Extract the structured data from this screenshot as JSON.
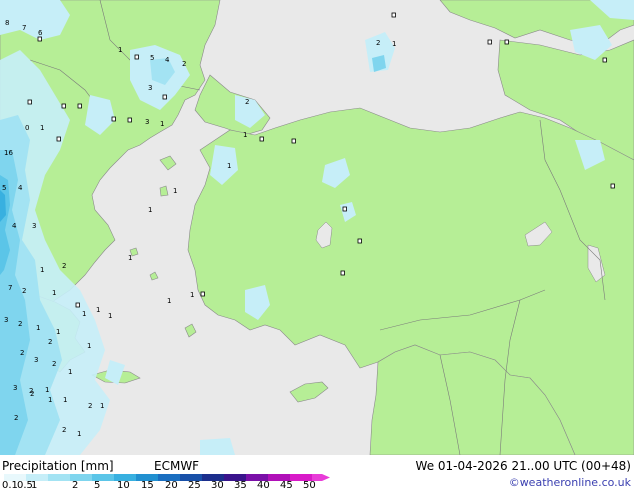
{
  "title": "Precipitation [mm]",
  "model": "ECMWF",
  "valid_time": "We 01-04-2026 21..00 UTC (00+48)",
  "credit": "©weatheronline.co.uk",
  "colors": {
    "sea": "#e9e9e9",
    "land": "#b6ee96",
    "border": "#7a7a7a",
    "coast": "#8a8a8a"
  },
  "legend": {
    "labels": [
      "0.1",
      "0.5",
      "1",
      "2",
      "5",
      "10",
      "15",
      "20",
      "25",
      "30",
      "35",
      "40",
      "45",
      "50"
    ],
    "colors": [
      "#e8f8fc",
      "#c6eef8",
      "#a3e3f3",
      "#7fd5ee",
      "#5bc5e8",
      "#38b0e0",
      "#2190d0",
      "#1a6ec0",
      "#1850a8",
      "#1c2e8c",
      "#3a148c",
      "#7a10a8",
      "#b010b8",
      "#d81ac8",
      "#e83cd8"
    ]
  },
  "map_labels": [
    {
      "t": "8"
    },
    {
      "t": "7"
    },
    {
      "t": "6"
    },
    {
      "t": "5"
    },
    {
      "t": "1"
    },
    {
      "t": "4"
    },
    {
      "t": "2"
    },
    {
      "t": "3"
    },
    {
      "t": "0"
    },
    {
      "t": "1"
    },
    {
      "t": "2"
    },
    {
      "t": "1"
    },
    {
      "t": "2"
    },
    {
      "t": "1"
    },
    {
      "t": "1"
    },
    {
      "t": "3"
    },
    {
      "t": "1"
    },
    {
      "t": "16"
    },
    {
      "t": "4"
    },
    {
      "t": "5"
    },
    {
      "t": "3"
    },
    {
      "t": "4"
    },
    {
      "t": "2"
    },
    {
      "t": "1"
    },
    {
      "t": "7"
    },
    {
      "t": "2"
    },
    {
      "t": "1"
    },
    {
      "t": "3"
    },
    {
      "t": "3"
    },
    {
      "t": "2"
    },
    {
      "t": "2"
    },
    {
      "t": "1"
    },
    {
      "t": "1"
    },
    {
      "t": "3"
    },
    {
      "t": "2"
    },
    {
      "t": "1"
    },
    {
      "t": "1"
    },
    {
      "t": "2"
    },
    {
      "t": "1"
    },
    {
      "t": "2"
    },
    {
      "t": "1"
    },
    {
      "t": "2"
    },
    {
      "t": "1"
    },
    {
      "t": "1"
    },
    {
      "t": "1"
    },
    {
      "t": "1"
    },
    {
      "t": "2"
    },
    {
      "t": "2"
    },
    {
      "t": "1"
    },
    {
      "t": "1"
    },
    {
      "t": "1"
    },
    {
      "t": "1"
    },
    {
      "t": "1"
    },
    {
      "t": "2"
    },
    {
      "t": "1"
    },
    {
      "t": "1"
    }
  ]
}
